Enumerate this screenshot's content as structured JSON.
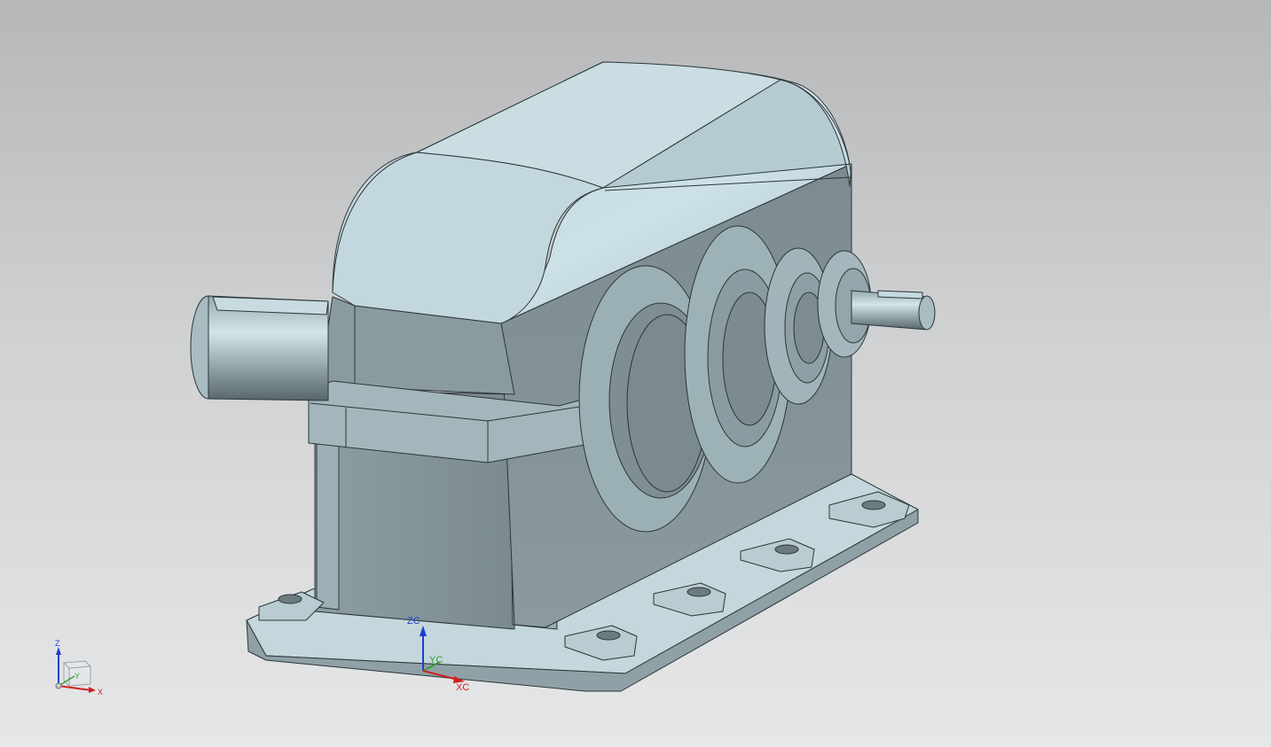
{
  "viewport": {
    "background_top": "#b5b7b9",
    "background_bottom": "#e6e7e8",
    "model_color": "#7f8f94",
    "model_highlight": "#c6dde3"
  },
  "wcs": {
    "z_label": "ZC",
    "y_label": "YC",
    "x_label": "XC"
  },
  "view_triad": {
    "z_label": "Z",
    "y_label": "Y",
    "x_label": "X"
  },
  "colors": {
    "axis_z": "#1f3fd0",
    "axis_y": "#3a9a3a",
    "axis_x": "#d02020"
  }
}
